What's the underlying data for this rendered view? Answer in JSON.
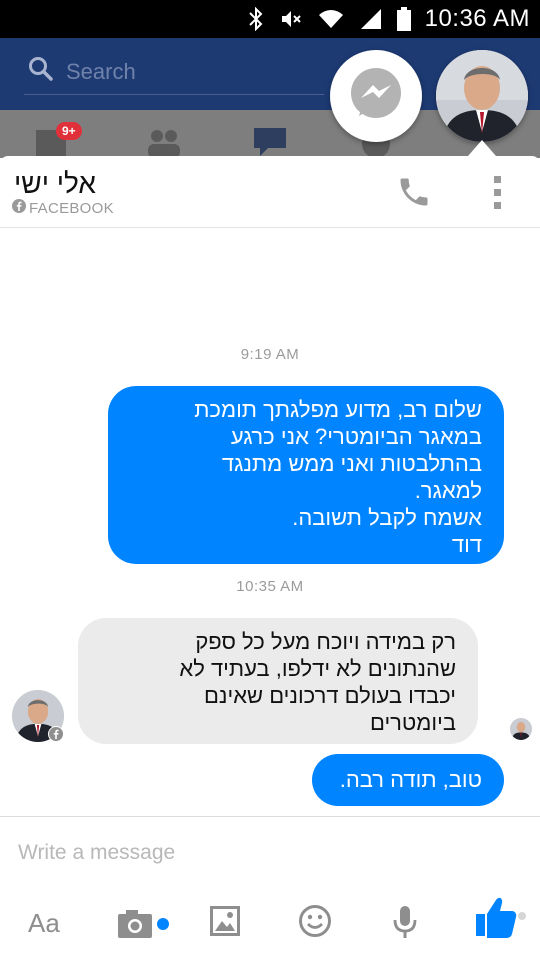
{
  "status_bar": {
    "time": "10:36 AM",
    "icons": [
      "bluetooth-icon",
      "mute-icon",
      "wifi-icon",
      "signal-icon",
      "battery-icon"
    ]
  },
  "fb_header": {
    "search_placeholder": "Search",
    "notification_badge": "9+"
  },
  "conversation": {
    "name": "אלי ישי",
    "source": "FACEBOOK",
    "call_icon": "phone-icon",
    "more_icon": "more-vert-icon"
  },
  "messages": [
    {
      "type": "timestamp",
      "text": "9:19 AM"
    },
    {
      "type": "outgoing",
      "lines": [
        "שלום רב, מדוע מפלגתך תומכת",
        "במאגר הביומטרי? אני כרגע",
        "בהתלבטות ואני ממש מתנגד",
        "למאגר.",
        "אשמח לקבל תשובה.",
        "דוד"
      ]
    },
    {
      "type": "timestamp",
      "text": "10:35 AM"
    },
    {
      "type": "incoming",
      "lines": [
        "רק במידה ויוכח מעל כל ספק",
        "שהנתונים לא ידלפו, בעתיד לא",
        "יכבדו בעולם דרכונים שאינם",
        "ביומטרים"
      ]
    },
    {
      "type": "outgoing",
      "lines": [
        "טוב, תודה רבה."
      ]
    }
  ],
  "composer": {
    "placeholder": "Write a message",
    "toolbar": {
      "text_label": "Aa",
      "icons": [
        "camera-icon",
        "image-icon",
        "emoji-icon",
        "microphone-icon",
        "like-icon"
      ]
    }
  },
  "colors": {
    "messenger_blue": "#0084ff",
    "facebook_navy": "#1d3a73",
    "incoming_bubble": "#ebebeb",
    "badge_red": "#e0303a"
  }
}
